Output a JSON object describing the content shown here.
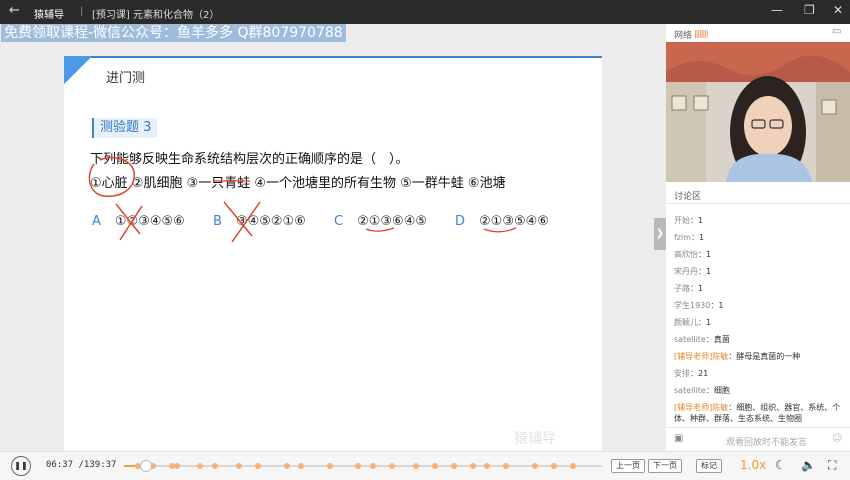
{
  "titlebar": {
    "app_name": "猿辅导",
    "separator": "|",
    "lesson_title": "[预习课] 元素和化合物（2）"
  },
  "watermark": "免费领取课程-微信公众号：鱼羊多多 Q群807970788",
  "slide": {
    "header": "进门测",
    "question_label": "测验题 3",
    "question_text": "下列能够反映生命系统结构层次的正确顺序的是（　）。",
    "items_text": "①心脏 ②肌细胞 ③一只青蛙 ④一个池塘里的所有生物 ⑤一群牛蛙 ⑥池塘",
    "choices": [
      {
        "letter": "A",
        "value": "①②③④⑤⑥"
      },
      {
        "letter": "B",
        "value": "③④⑤②①⑥"
      },
      {
        "letter": "C",
        "value": "②①③⑥④⑤"
      },
      {
        "letter": "D",
        "value": "②①③⑤④⑥"
      }
    ],
    "logo_watermark": "猿辅导"
  },
  "right_panel": {
    "network_label": "网络",
    "signal_bars": "||||||||",
    "chat_title": "讨论区",
    "chat": [
      {
        "name": "开始",
        "msg": "1",
        "teacher": false
      },
      {
        "name": "fzlm",
        "msg": "1",
        "teacher": false
      },
      {
        "name": "高欣怡",
        "msg": "1",
        "teacher": false
      },
      {
        "name": "宋丹丹",
        "msg": "1",
        "teacher": false
      },
      {
        "name": "子路",
        "msg": "1",
        "teacher": false
      },
      {
        "name": "学生1930",
        "msg": "1",
        "teacher": false
      },
      {
        "name": "颜颖儿",
        "msg": "1",
        "teacher": false
      },
      {
        "name": "satellite",
        "msg": "真菌",
        "teacher": false
      },
      {
        "name": "[辅导老师]陈敏",
        "msg": "酵母是真菌的一种",
        "teacher": true
      },
      {
        "name": "安排",
        "msg": "21",
        "teacher": false
      },
      {
        "name": "satellite",
        "msg": "细胞",
        "teacher": false
      },
      {
        "name": "[辅导老师]陈敏",
        "msg": "细胞、组织、器官、系统、个体、种群、群落、生态系统、生物圈",
        "teacher": true
      }
    ],
    "chat_placeholder": "观看回放时不能发言"
  },
  "player": {
    "current_time": "06:37",
    "total_time": "/139:37",
    "progress": 0.047,
    "markers": [
      0.03,
      0.06,
      0.1,
      0.11,
      0.16,
      0.19,
      0.24,
      0.28,
      0.34,
      0.37,
      0.43,
      0.49,
      0.52,
      0.56,
      0.61,
      0.65,
      0.69,
      0.73,
      0.76,
      0.8,
      0.86,
      0.9,
      0.94
    ],
    "prev_label": "上一页",
    "next_label": "下一页",
    "mark_label": "标记",
    "speed": "1.0x",
    "accent_color": "#f29b4a"
  }
}
